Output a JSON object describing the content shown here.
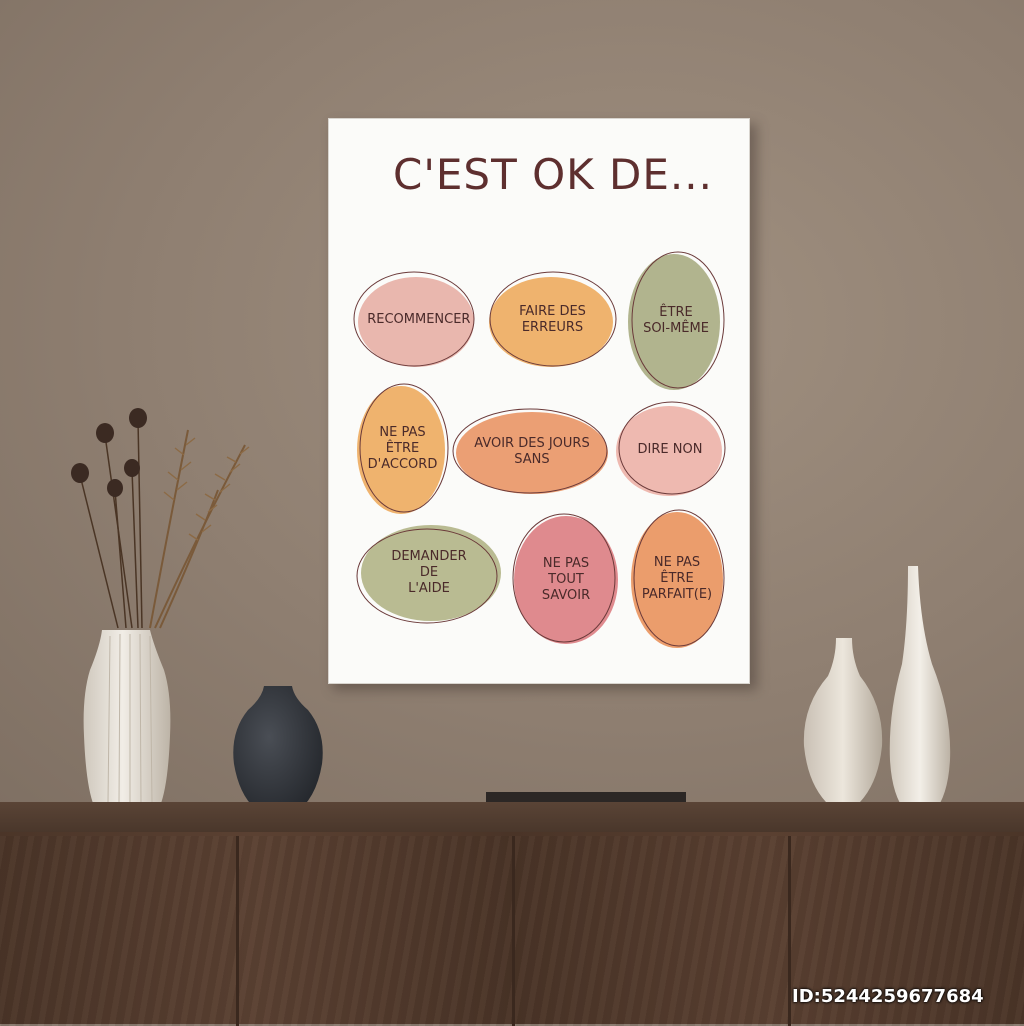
{
  "poster": {
    "title": "C'EST OK DE...",
    "items": [
      {
        "label": "RECOMMENCER",
        "color": "#e9b7ae"
      },
      {
        "label": "FAIRE DES\nERREURS",
        "color": "#efb36e"
      },
      {
        "label": "ÊTRE\nSOI-MÊME",
        "color": "#b1b48e"
      },
      {
        "label": "NE PAS\nÊTRE\nD'ACCORD",
        "color": "#efb36e"
      },
      {
        "label": "AVOIR DES JOURS\nSANS",
        "color": "#eb9f74"
      },
      {
        "label": "DIRE NON",
        "color": "#eeb9b0"
      },
      {
        "label": "DEMANDER\nDE\nL'AIDE",
        "color": "#b9bb92"
      },
      {
        "label": "NE PAS\nTOUT\nSAVOIR",
        "color": "#df8a8e"
      },
      {
        "label": "NE PAS\nÊTRE\nPARFAIT(E)",
        "color": "#eb9d6c"
      }
    ]
  },
  "watermark": "ID:5244259677684",
  "colors": {
    "title": "#5e2f2f",
    "outline": "#6b3a3a",
    "wall": "#958576",
    "cabinet": "#4f392c"
  },
  "objects": [
    "dried-flowers",
    "white-vase",
    "dark-vase",
    "book",
    "small-vase",
    "tall-vase"
  ]
}
